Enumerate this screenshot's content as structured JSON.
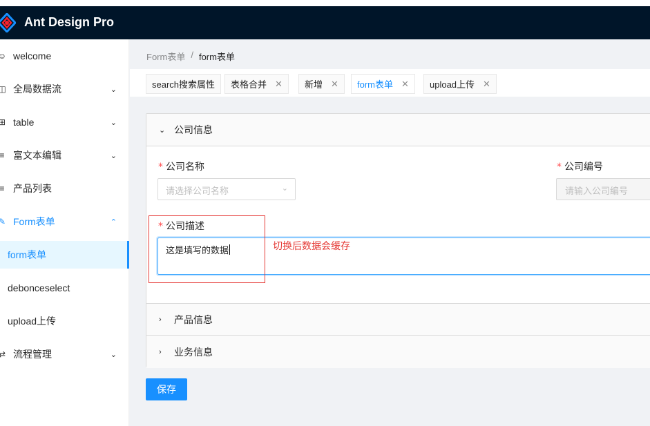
{
  "app": {
    "title": "Ant Design Pro"
  },
  "sidebar": {
    "items": [
      {
        "icon": "smile-icon",
        "glyph": "☺",
        "label": "welcome",
        "arrow": ""
      },
      {
        "icon": "dashboard-icon",
        "glyph": "◫",
        "label": "全局数据流",
        "arrow": "⌄"
      },
      {
        "icon": "table-icon",
        "glyph": "⊞",
        "label": "table",
        "arrow": "⌄"
      },
      {
        "icon": "edit-icon",
        "glyph": "≡",
        "label": "富文本编辑",
        "arrow": "⌄"
      },
      {
        "icon": "list-icon",
        "glyph": "≡",
        "label": "产品列表",
        "arrow": ""
      },
      {
        "icon": "form-icon",
        "glyph": "✎",
        "label": "Form表单",
        "arrow": "⌃"
      },
      {
        "label": "form表单"
      },
      {
        "label": "debonceselect"
      },
      {
        "label": "upload上传"
      },
      {
        "icon": "flow-icon",
        "glyph": "⇄",
        "label": "流程管理",
        "arrow": "⌄"
      }
    ]
  },
  "breadcrumb": {
    "parent": "Form表单",
    "separator": "/",
    "current": "form表单"
  },
  "tabs": [
    {
      "label": "search搜索属性",
      "closable": false
    },
    {
      "label": "表格合并",
      "closable": true
    },
    {
      "label": "新增",
      "closable": true
    },
    {
      "label": "form表单",
      "closable": true,
      "active": true
    },
    {
      "label": "upload上传",
      "closable": true
    }
  ],
  "close_glyph": "✕",
  "form": {
    "section1": {
      "title": "公司信息",
      "expanded": true
    },
    "company_name": {
      "label": "公司名称",
      "placeholder": "请选择公司名称"
    },
    "company_code": {
      "label": "公司编号",
      "placeholder": "请输入公司编号"
    },
    "company_desc": {
      "label": "公司描述",
      "value": "这是填写的数据"
    },
    "section2": {
      "title": "产品信息",
      "expanded": false
    },
    "section3": {
      "title": "业务信息",
      "expanded": false
    },
    "required_mark": "*",
    "save_label": "保存"
  },
  "annotation": {
    "text": "切换后数据会缓存",
    "color": "#e53935"
  },
  "colors": {
    "primary": "#1890ff",
    "header_bg": "#001529",
    "required": "#ff4d4f"
  }
}
